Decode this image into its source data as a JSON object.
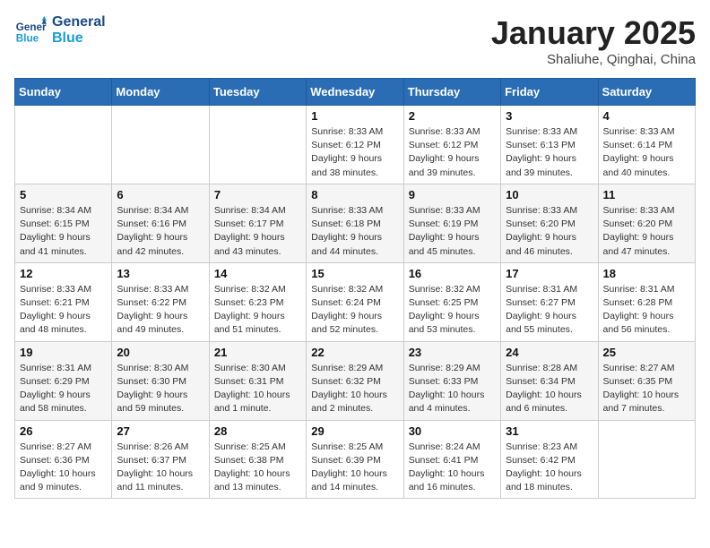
{
  "logo": {
    "line1": "General",
    "line2": "Blue"
  },
  "title": "January 2025",
  "subtitle": "Shaliuhe, Qinghai, China",
  "weekdays": [
    "Sunday",
    "Monday",
    "Tuesday",
    "Wednesday",
    "Thursday",
    "Friday",
    "Saturday"
  ],
  "weeks": [
    [
      null,
      null,
      null,
      {
        "day": "1",
        "sunrise": "Sunrise: 8:33 AM",
        "sunset": "Sunset: 6:12 PM",
        "daylight": "Daylight: 9 hours and 38 minutes."
      },
      {
        "day": "2",
        "sunrise": "Sunrise: 8:33 AM",
        "sunset": "Sunset: 6:12 PM",
        "daylight": "Daylight: 9 hours and 39 minutes."
      },
      {
        "day": "3",
        "sunrise": "Sunrise: 8:33 AM",
        "sunset": "Sunset: 6:13 PM",
        "daylight": "Daylight: 9 hours and 39 minutes."
      },
      {
        "day": "4",
        "sunrise": "Sunrise: 8:33 AM",
        "sunset": "Sunset: 6:14 PM",
        "daylight": "Daylight: 9 hours and 40 minutes."
      }
    ],
    [
      {
        "day": "5",
        "sunrise": "Sunrise: 8:34 AM",
        "sunset": "Sunset: 6:15 PM",
        "daylight": "Daylight: 9 hours and 41 minutes."
      },
      {
        "day": "6",
        "sunrise": "Sunrise: 8:34 AM",
        "sunset": "Sunset: 6:16 PM",
        "daylight": "Daylight: 9 hours and 42 minutes."
      },
      {
        "day": "7",
        "sunrise": "Sunrise: 8:34 AM",
        "sunset": "Sunset: 6:17 PM",
        "daylight": "Daylight: 9 hours and 43 minutes."
      },
      {
        "day": "8",
        "sunrise": "Sunrise: 8:33 AM",
        "sunset": "Sunset: 6:18 PM",
        "daylight": "Daylight: 9 hours and 44 minutes."
      },
      {
        "day": "9",
        "sunrise": "Sunrise: 8:33 AM",
        "sunset": "Sunset: 6:19 PM",
        "daylight": "Daylight: 9 hours and 45 minutes."
      },
      {
        "day": "10",
        "sunrise": "Sunrise: 8:33 AM",
        "sunset": "Sunset: 6:20 PM",
        "daylight": "Daylight: 9 hours and 46 minutes."
      },
      {
        "day": "11",
        "sunrise": "Sunrise: 8:33 AM",
        "sunset": "Sunset: 6:20 PM",
        "daylight": "Daylight: 9 hours and 47 minutes."
      }
    ],
    [
      {
        "day": "12",
        "sunrise": "Sunrise: 8:33 AM",
        "sunset": "Sunset: 6:21 PM",
        "daylight": "Daylight: 9 hours and 48 minutes."
      },
      {
        "day": "13",
        "sunrise": "Sunrise: 8:33 AM",
        "sunset": "Sunset: 6:22 PM",
        "daylight": "Daylight: 9 hours and 49 minutes."
      },
      {
        "day": "14",
        "sunrise": "Sunrise: 8:32 AM",
        "sunset": "Sunset: 6:23 PM",
        "daylight": "Daylight: 9 hours and 51 minutes."
      },
      {
        "day": "15",
        "sunrise": "Sunrise: 8:32 AM",
        "sunset": "Sunset: 6:24 PM",
        "daylight": "Daylight: 9 hours and 52 minutes."
      },
      {
        "day": "16",
        "sunrise": "Sunrise: 8:32 AM",
        "sunset": "Sunset: 6:25 PM",
        "daylight": "Daylight: 9 hours and 53 minutes."
      },
      {
        "day": "17",
        "sunrise": "Sunrise: 8:31 AM",
        "sunset": "Sunset: 6:27 PM",
        "daylight": "Daylight: 9 hours and 55 minutes."
      },
      {
        "day": "18",
        "sunrise": "Sunrise: 8:31 AM",
        "sunset": "Sunset: 6:28 PM",
        "daylight": "Daylight: 9 hours and 56 minutes."
      }
    ],
    [
      {
        "day": "19",
        "sunrise": "Sunrise: 8:31 AM",
        "sunset": "Sunset: 6:29 PM",
        "daylight": "Daylight: 9 hours and 58 minutes."
      },
      {
        "day": "20",
        "sunrise": "Sunrise: 8:30 AM",
        "sunset": "Sunset: 6:30 PM",
        "daylight": "Daylight: 9 hours and 59 minutes."
      },
      {
        "day": "21",
        "sunrise": "Sunrise: 8:30 AM",
        "sunset": "Sunset: 6:31 PM",
        "daylight": "Daylight: 10 hours and 1 minute."
      },
      {
        "day": "22",
        "sunrise": "Sunrise: 8:29 AM",
        "sunset": "Sunset: 6:32 PM",
        "daylight": "Daylight: 10 hours and 2 minutes."
      },
      {
        "day": "23",
        "sunrise": "Sunrise: 8:29 AM",
        "sunset": "Sunset: 6:33 PM",
        "daylight": "Daylight: 10 hours and 4 minutes."
      },
      {
        "day": "24",
        "sunrise": "Sunrise: 8:28 AM",
        "sunset": "Sunset: 6:34 PM",
        "daylight": "Daylight: 10 hours and 6 minutes."
      },
      {
        "day": "25",
        "sunrise": "Sunrise: 8:27 AM",
        "sunset": "Sunset: 6:35 PM",
        "daylight": "Daylight: 10 hours and 7 minutes."
      }
    ],
    [
      {
        "day": "26",
        "sunrise": "Sunrise: 8:27 AM",
        "sunset": "Sunset: 6:36 PM",
        "daylight": "Daylight: 10 hours and 9 minutes."
      },
      {
        "day": "27",
        "sunrise": "Sunrise: 8:26 AM",
        "sunset": "Sunset: 6:37 PM",
        "daylight": "Daylight: 10 hours and 11 minutes."
      },
      {
        "day": "28",
        "sunrise": "Sunrise: 8:25 AM",
        "sunset": "Sunset: 6:38 PM",
        "daylight": "Daylight: 10 hours and 13 minutes."
      },
      {
        "day": "29",
        "sunrise": "Sunrise: 8:25 AM",
        "sunset": "Sunset: 6:39 PM",
        "daylight": "Daylight: 10 hours and 14 minutes."
      },
      {
        "day": "30",
        "sunrise": "Sunrise: 8:24 AM",
        "sunset": "Sunset: 6:41 PM",
        "daylight": "Daylight: 10 hours and 16 minutes."
      },
      {
        "day": "31",
        "sunrise": "Sunrise: 8:23 AM",
        "sunset": "Sunset: 6:42 PM",
        "daylight": "Daylight: 10 hours and 18 minutes."
      },
      null
    ]
  ]
}
